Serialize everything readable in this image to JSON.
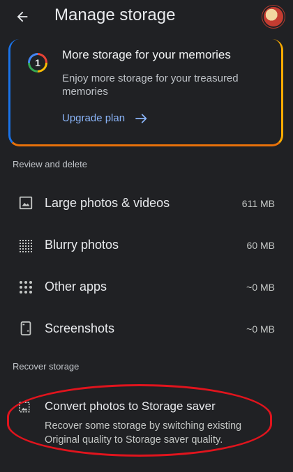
{
  "appbar": {
    "title": "Manage storage"
  },
  "promo": {
    "badge_number": "1",
    "title": "More storage for your memories",
    "description": "Enjoy more storage for your treasured memories",
    "link_label": "Upgrade plan"
  },
  "review": {
    "heading": "Review and delete",
    "items": [
      {
        "label": "Large photos & videos",
        "value": "611 MB",
        "icon": "photo-icon"
      },
      {
        "label": "Blurry photos",
        "value": "60 MB",
        "icon": "blur-icon"
      },
      {
        "label": "Other apps",
        "value": "~0 MB",
        "icon": "apps-grid-icon"
      },
      {
        "label": "Screenshots",
        "value": "~0 MB",
        "icon": "screenshot-icon"
      }
    ]
  },
  "recover": {
    "heading": "Recover storage",
    "title": "Convert photos to Storage saver",
    "description": "Recover some storage by switching existing Original quality to Storage saver quality."
  },
  "colors": {
    "background": "#202124",
    "accent_link": "#8ab4f8",
    "highlight_oval": "#e0141d"
  }
}
